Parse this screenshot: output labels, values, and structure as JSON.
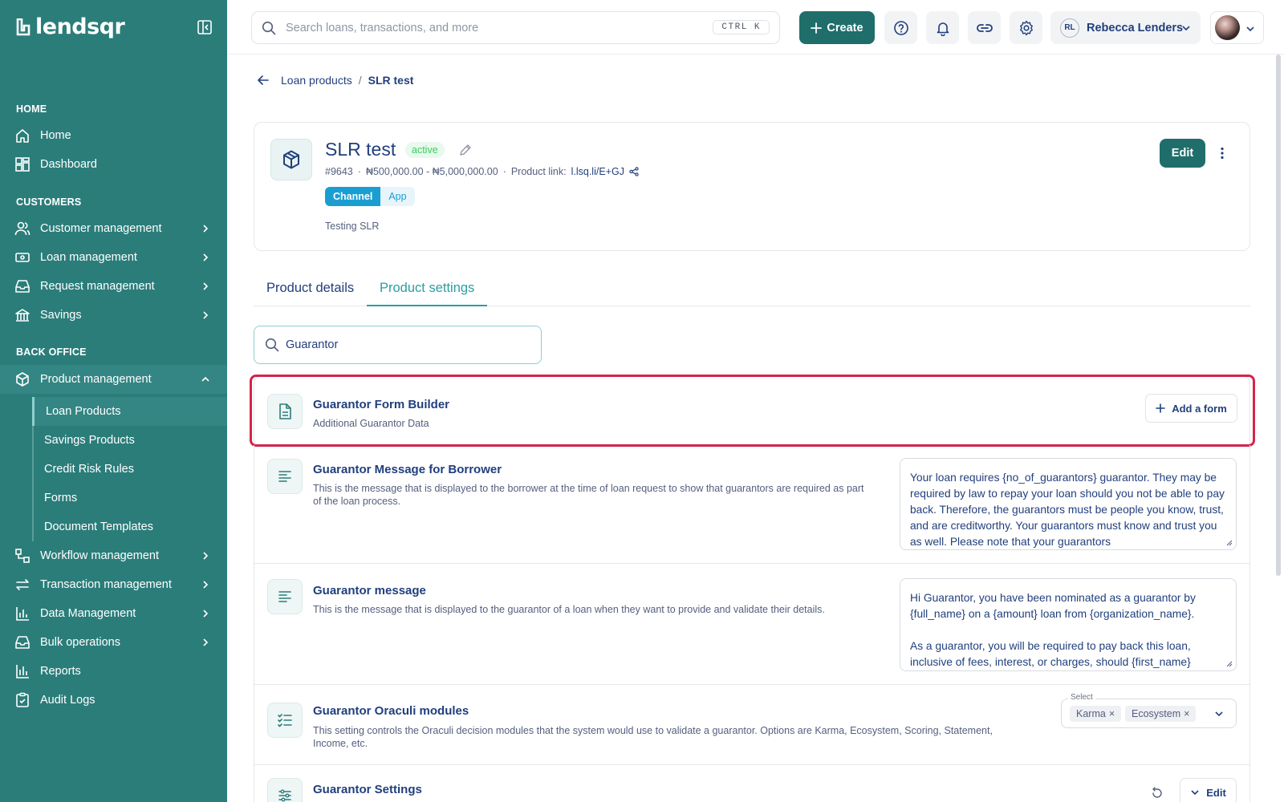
{
  "brand": {
    "name": "lendsqr"
  },
  "sidebar": {
    "sections": {
      "home": "HOME",
      "customers": "CUSTOMERS",
      "back_office": "BACK OFFICE"
    },
    "items": {
      "home": "Home",
      "dashboard": "Dashboard",
      "customer_management": "Customer management",
      "loan_management": "Loan management",
      "request_management": "Request management",
      "savings": "Savings",
      "product_management": "Product management",
      "workflow_management": "Workflow management",
      "transaction_management": "Transaction management",
      "data_management": "Data Management",
      "bulk_operations": "Bulk operations",
      "reports": "Reports",
      "audit_logs": "Audit Logs"
    },
    "sub_items": {
      "loan_products": "Loan Products",
      "savings_products": "Savings Products",
      "credit_risk_rules": "Credit Risk Rules",
      "forms": "Forms",
      "document_templates": "Document Templates"
    }
  },
  "topbar": {
    "search_placeholder": "Search loans, transactions, and more",
    "shortcut": "CTRL K",
    "create_label": "Create",
    "user_initials": "RL",
    "user_name": "Rebecca Lenders"
  },
  "breadcrumb": {
    "parent": "Loan products",
    "separator": "/",
    "current": "SLR test"
  },
  "product": {
    "title": "SLR test",
    "status": "active",
    "id": "#9643",
    "amount_range": "₦500,000.00 - ₦5,000,000.00",
    "link_label": "Product link:",
    "link": "l.lsq.li/E+GJ",
    "dot": "·",
    "channel_label": "Channel",
    "channel_value": "App",
    "description": "Testing SLR",
    "edit_label": "Edit"
  },
  "tabs": {
    "details": "Product details",
    "settings": "Product settings"
  },
  "filter": {
    "value": "Guarantor"
  },
  "settings": {
    "form_builder": {
      "title": "Guarantor Form Builder",
      "desc": "Additional Guarantor Data",
      "action": "Add a form"
    },
    "message_borrower": {
      "title": "Guarantor Message for Borrower",
      "desc": "This is the message that is displayed to the borrower at the time of loan request to show that guarantors are required as part of the loan process.",
      "value": "Your loan requires {no_of_guarantors} guarantor. They may be required by law to repay your loan should you not be able to pay back. Therefore, the guarantors must be people you know, trust, and are creditworthy. Your guarantors must know and trust you as well. Please note that your guarantors"
    },
    "message_guarantor": {
      "title": "Guarantor message",
      "desc": "This is the message that is displayed to the guarantor of a loan when they want to provide and validate their details.",
      "value_p1": "Hi Guarantor, you have been nominated as a guarantor by {full_name} on a {amount} loan from {organization_name}.",
      "value_p2": "As a guarantor, you will be required to pay back this loan, inclusive of fees, interest, or charges, should {first_name}"
    },
    "oraculi": {
      "title": "Guarantor Oraculi modules",
      "desc": "This setting controls the Oraculi decision modules that the system would use to validate a guarantor. Options are Karma, Ecosystem, Scoring, Statement, Income, etc.",
      "select_label": "Select",
      "tags": [
        "Karma",
        "Ecosystem"
      ],
      "remove_glyph": "×"
    },
    "guarantor_settings": {
      "title": "Guarantor Settings",
      "edit_label": "Edit"
    }
  },
  "colors": {
    "sidebar": "#2b7d7a",
    "primary": "#1f6e6b",
    "accent": "#2b9ea0",
    "highlight": "#d42549",
    "text": "#213f7d"
  }
}
